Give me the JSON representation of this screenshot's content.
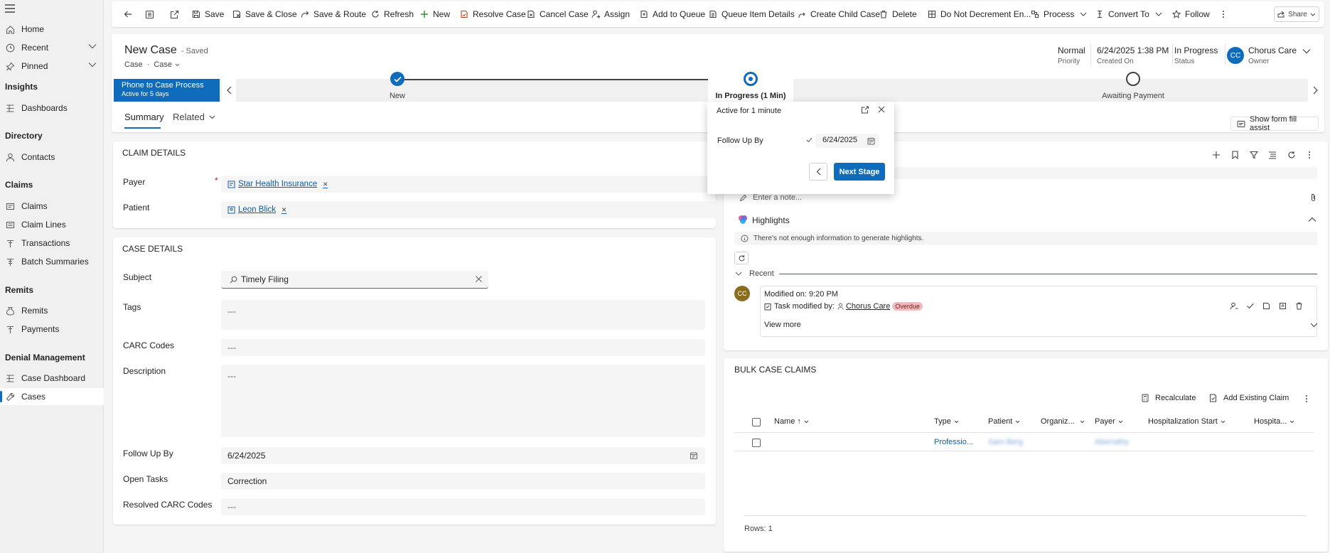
{
  "sidebar": {
    "items": [
      {
        "label": "Home",
        "icon": "home-icon"
      },
      {
        "label": "Recent",
        "icon": "clock-icon",
        "expandable": true
      },
      {
        "label": "Pinned",
        "icon": "pin-icon",
        "expandable": true
      }
    ],
    "groups": [
      {
        "title": "Insights",
        "items": [
          {
            "label": "Dashboards",
            "icon": "dashboard-icon"
          }
        ]
      },
      {
        "title": "Directory",
        "items": [
          {
            "label": "Contacts",
            "icon": "person-icon"
          }
        ]
      },
      {
        "title": "Claims",
        "items": [
          {
            "label": "Claims",
            "icon": "claims-icon"
          },
          {
            "label": "Claim Lines",
            "icon": "claim-lines-icon"
          },
          {
            "label": "Transactions",
            "icon": "transactions-icon"
          },
          {
            "label": "Batch Summaries",
            "icon": "batch-icon"
          }
        ]
      },
      {
        "title": "Remits",
        "items": [
          {
            "label": "Remits",
            "icon": "remits-icon"
          },
          {
            "label": "Payments",
            "icon": "payments-icon"
          }
        ]
      },
      {
        "title": "Denial Management",
        "items": [
          {
            "label": "Case Dashboard",
            "icon": "dashboard-icon"
          },
          {
            "label": "Cases",
            "icon": "wrench-icon",
            "active": true
          }
        ]
      }
    ]
  },
  "toolbar": {
    "save": "Save",
    "save_close": "Save & Close",
    "save_route": "Save & Route",
    "refresh": "Refresh",
    "new": "New",
    "resolve_case": "Resolve Case",
    "cancel_case": "Cancel Case",
    "assign": "Assign",
    "add_to_queue": "Add to Queue",
    "queue_item_details": "Queue Item Details",
    "create_child_case": "Create Child Case",
    "delete": "Delete",
    "do_not_decrement": "Do Not Decrement En...",
    "process": "Process",
    "convert_to": "Convert To",
    "follow": "Follow",
    "share": "Share"
  },
  "header": {
    "title": "New Case",
    "saved_state": "- Saved",
    "entity": "Case",
    "separator": "·",
    "form": "Case",
    "priority_value": "Normal",
    "priority_label": "Priority",
    "created_value": "6/24/2025 1:38 PM",
    "created_label": "Created On",
    "status_value": "In Progress",
    "status_label": "Status",
    "owner_initials": "CC",
    "owner_name": "Chorus Care",
    "owner_label": "Owner"
  },
  "bpf": {
    "process_name": "Phone to Case Process",
    "process_active": "Active for 5 days",
    "stages": [
      {
        "label": "New",
        "state": "completed"
      },
      {
        "label": "In Progress",
        "duration": "(1 Min)",
        "state": "active"
      },
      {
        "label": "Awaiting Payment",
        "state": "pending"
      }
    ]
  },
  "stage_flyout": {
    "title": "Active for 1 minute",
    "field_label": "Follow Up By",
    "field_value": "6/24/2025",
    "next_label": "Next Stage"
  },
  "tabs": {
    "summary": "Summary",
    "related": "Related"
  },
  "form_fill": "Show form fill assist",
  "claim_details": {
    "title": "CLAIM DETAILS",
    "payer_label": "Payer",
    "payer_value": "Star Health Insurance",
    "patient_label": "Patient",
    "patient_value": "Leon Blick"
  },
  "case_details": {
    "title": "CASE DETAILS",
    "subject_label": "Subject",
    "subject_value": "Timely Filing",
    "tags_label": "Tags",
    "tags_value": "---",
    "carc_label": "CARC Codes",
    "carc_value": "---",
    "description_label": "Description",
    "description_value": "---",
    "followup_label": "Follow Up By",
    "followup_value": "6/24/2025",
    "open_tasks_label": "Open Tasks",
    "open_tasks_value": "Correction",
    "resolved_carc_label": "Resolved CARC Codes",
    "resolved_carc_value": "---"
  },
  "timeline": {
    "note_placeholder": "Enter a note...",
    "highlights_label": "Highlights",
    "highlights_empty": "There's not enough information to generate highlights.",
    "recent_label": "Recent",
    "entry": {
      "avatar": "CC",
      "modified": "Modified on: 9:20 PM",
      "task_prefix": "Task modified by:",
      "user": "Chorus Care",
      "badge": "Overdue",
      "view_more": "View more"
    }
  },
  "bulk_claims": {
    "title": "BULK CASE CLAIMS",
    "recalculate": "Recalculate",
    "add_existing": "Add Existing Claim",
    "columns": [
      "Name ↑",
      "Type",
      "Patient",
      "Organiz...",
      "Payer",
      "Hospitalization Start",
      "Hospita..."
    ],
    "rows": [
      {
        "name": "",
        "type": "Professio...",
        "patient": "Sam Berg",
        "organization": "",
        "payer": "Aberrathy"
      }
    ],
    "rows_count": "Rows: 1"
  }
}
